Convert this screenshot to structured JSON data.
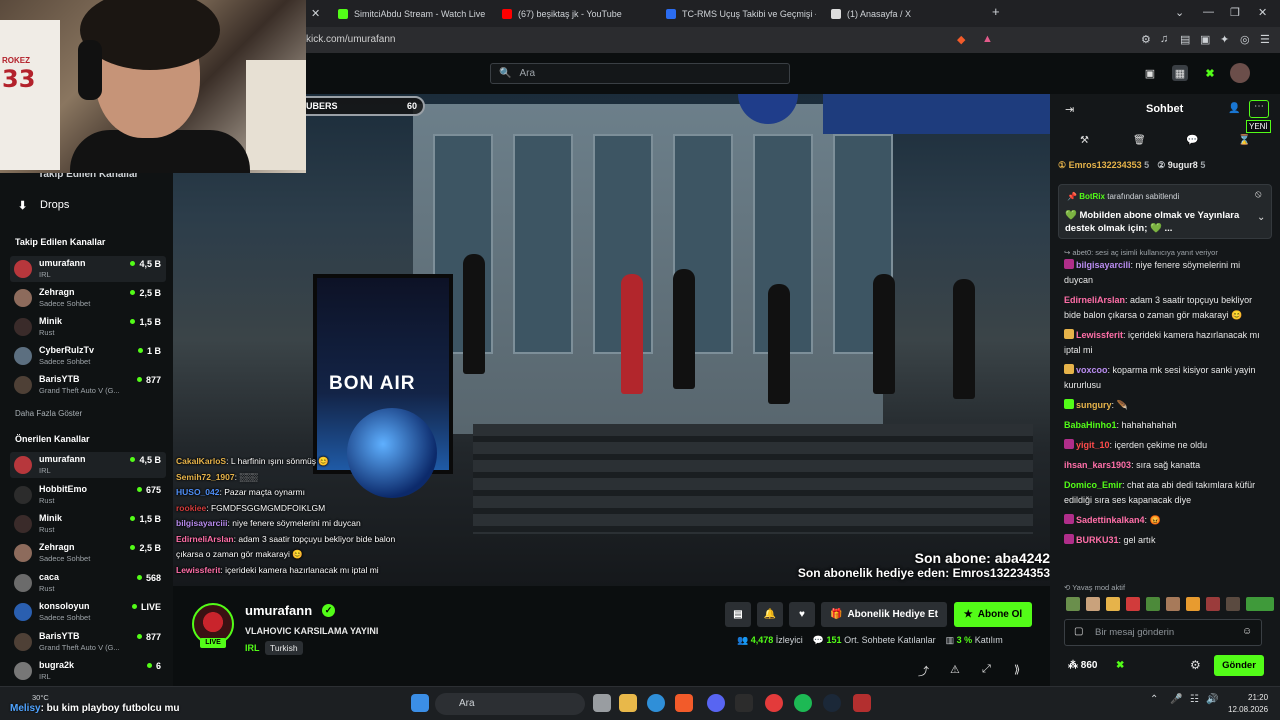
{
  "browser": {
    "tabs": [
      {
        "title": "SimitciAbdu Stream - Watch Live on K",
        "color": "#53fc18"
      },
      {
        "title": "(67) beşiktaş jk - YouTube",
        "color": "#ff0000"
      },
      {
        "title": "TC-RMS Uçuş Takibi ve Geçmişi - Fligh",
        "color": "#2b6cf0"
      },
      {
        "title": "(1) Anasayfa / X",
        "color": "#ffffff"
      }
    ],
    "new_tab": "+",
    "url": "kick.com/umurafann"
  },
  "header": {
    "search_placeholder": "Ara",
    "search_icon": "🔍"
  },
  "sidebar": {
    "prev_item": "Takip Edilen Kanallar",
    "drops_label": "Drops",
    "followed_heading": "Takip Edilen Kanallar",
    "followed": [
      {
        "name": "umurafann",
        "category": "IRL",
        "viewers": "4,5 B",
        "avatar": "#b7373c"
      },
      {
        "name": "Zehragn",
        "category": "Sadece Sohbet",
        "viewers": "2,5 B",
        "avatar": "#8d6b5c"
      },
      {
        "name": "Minik",
        "category": "Rust",
        "viewers": "1,5 B",
        "avatar": "#3a2b2a"
      },
      {
        "name": "CyberRulzTv",
        "category": "Sadece Sohbet",
        "viewers": "1 B",
        "avatar": "#5c6f80"
      },
      {
        "name": "BarisYTB",
        "category": "Grand Theft Auto V (G...",
        "viewers": "877",
        "avatar": "#4e4036"
      }
    ],
    "show_more": "Daha Fazla Göster",
    "recommended_heading": "Önerilen Kanallar",
    "recommended": [
      {
        "name": "umurafann",
        "category": "IRL",
        "viewers": "4,5 B",
        "avatar": "#b7373c"
      },
      {
        "name": "HobbitEmo",
        "category": "Rust",
        "viewers": "675",
        "avatar": "#2c2c2c"
      },
      {
        "name": "Minik",
        "category": "Rust",
        "viewers": "1,5 B",
        "avatar": "#3a2b2a"
      },
      {
        "name": "Zehragn",
        "category": "Sadece Sohbet",
        "viewers": "2,5 B",
        "avatar": "#8d6b5c"
      },
      {
        "name": "caca",
        "category": "Rust",
        "viewers": "568",
        "avatar": "#6b6b6b"
      },
      {
        "name": "konsoloyun",
        "category": "Sadece Sohbet",
        "viewers": "LIVE",
        "avatar": "#2a5fb0"
      },
      {
        "name": "BarisYTB",
        "category": "Grand Theft Auto V (G...",
        "viewers": "877",
        "avatar": "#4e4036"
      },
      {
        "name": "bugra2k",
        "category": "IRL",
        "viewers": "6",
        "avatar": "#777777"
      }
    ]
  },
  "webcam": {
    "jersey_name": "ROKEZ",
    "jersey_number": "33"
  },
  "video": {
    "subs_goal_label": "UBERS",
    "subs_goal_value": "60",
    "poster_text": "BON AIR",
    "overlay_chat": [
      {
        "user": "CakalKarloS",
        "color": "#e6b34a",
        "text": ": L harfinin ışını sönmüş 😊"
      },
      {
        "user": "Semih72_1907",
        "color": "#e6b34a",
        "text": ": ░░░"
      },
      {
        "user": "HUSO_042",
        "color": "#4f8ff7",
        "text": ": Pazar maçta oynarmı"
      },
      {
        "user": "rookiee",
        "color": "#d13b3b",
        "text": ": FGMDFSGGMGMDFOIKLGM"
      },
      {
        "user": "bilgisayarciii",
        "color": "#b98cf0",
        "text": ": niye fenere söymelerini mi duycan"
      },
      {
        "user": "EdirneliArslan",
        "color": "#ff6fa8",
        "text": ": adam 3 saatir topçuyu bekliyor bide balon"
      },
      {
        "user": "",
        "color": "#ffffff",
        "text": "çıkarsa o zaman gör makarayi 😊"
      },
      {
        "user": "Lewissferit",
        "color": "#ff6fa8",
        "text": ": içerideki kamera hazırlanacak mı iptal mi"
      }
    ],
    "sub_notice_1": "Son abone: aba4242",
    "sub_notice_2": "Son abonelik hediye eden: Emros132234353"
  },
  "stream": {
    "live_badge": "LIVE",
    "streamer": "umurafann",
    "title": "VLAHOVIC KARSILAMA YAYINI",
    "category": "IRL",
    "language": "Turkish",
    "gift_button": "Abonelik Hediye Et",
    "sub_button": "Abone Ol",
    "viewers": "4,478",
    "viewers_label": "İzleyici",
    "chatters": "151",
    "chatters_label": "Ort. Sohbete Katılanlar",
    "participation": "3 %",
    "participation_label": "Katılım"
  },
  "chat": {
    "title": "Sohbet",
    "new_label": "YENİ",
    "gifters": [
      {
        "name": "Emros132234353",
        "count": "5",
        "color": "#e6b34a"
      },
      {
        "name": "9ugur8",
        "count": "5",
        "color": "#e8e8e8"
      }
    ],
    "pinned_by": "BotRix",
    "pinned_by_suffix": "tarafından sabitlendi",
    "pinned_text": "💚 Mobilden abone olmak ve Yayınlara destek olmak için; 💚 ...",
    "messages": [
      {
        "reply": "↪ abet0: sesi aç isimli kullanıcıya yanıt veriyor",
        "user": "bilgisayarcili",
        "color": "#b98cf0",
        "badge": "#b02e8a",
        "text": ": niye fenere söymelerini mi duycan"
      },
      {
        "reply": "",
        "user": "EdirneliArslan",
        "color": "#ff6fa8",
        "badge": "",
        "text": ": adam 3 saatir topçuyu bekliyor bide balon çıkarsa o zaman gör makarayi 😊"
      },
      {
        "reply": "",
        "user": "Lewissferit",
        "color": "#ff6fa8",
        "badge": "#e6b34a",
        "text": ": içerideki kamera hazırlanacak mı iptal mi"
      },
      {
        "reply": "",
        "user": "voxcoo",
        "color": "#b98cf0",
        "badge": "#e6b34a",
        "text": ": koparma mk sesi kisiyor sanki yayin kururlusu"
      },
      {
        "reply": "",
        "user": "sungury",
        "color": "#e6b34a",
        "badge": "#53fc18",
        "text": ": 🪶"
      },
      {
        "reply": "",
        "user": "BabaHinho1",
        "color": "#53fc18",
        "badge": "",
        "text": ": hahahahahah"
      },
      {
        "reply": "",
        "user": "yigit_10",
        "color": "#ff4b4b",
        "badge": "#b02e8a",
        "text": ": içerden çekime ne oldu"
      },
      {
        "reply": "",
        "user": "ihsan_kars1903",
        "color": "#ff6fa8",
        "badge": "",
        "text": ": sıra sağ kanatta"
      },
      {
        "reply": "",
        "user": "Domico_Emir",
        "color": "#53fc18",
        "badge": "",
        "text": ": chat ata abi dedi takımlara küfür edildiği sıra ses kapanacak diye"
      },
      {
        "reply": "",
        "user": "Sadettinkalkan4",
        "color": "#ff6fa8",
        "badge": "#b02e8a",
        "text": ": 😡"
      },
      {
        "reply": "",
        "user": "BURKU31",
        "color": "#ff6fa8",
        "badge": "#b02e8a",
        "text": ": gel artık"
      }
    ],
    "slow_mode": "⟲ Yavaş mod aktif",
    "input_placeholder": "Bir mesaj gönderin",
    "points": "860",
    "send_button": "Gönder"
  },
  "taskbar": {
    "weather": "30°C",
    "search_placeholder": "Ara",
    "overlay_user": "Melisy",
    "overlay_text": ": bu kim playboy futbolcu mu",
    "time": "21:20",
    "date": "12.08.2026"
  }
}
